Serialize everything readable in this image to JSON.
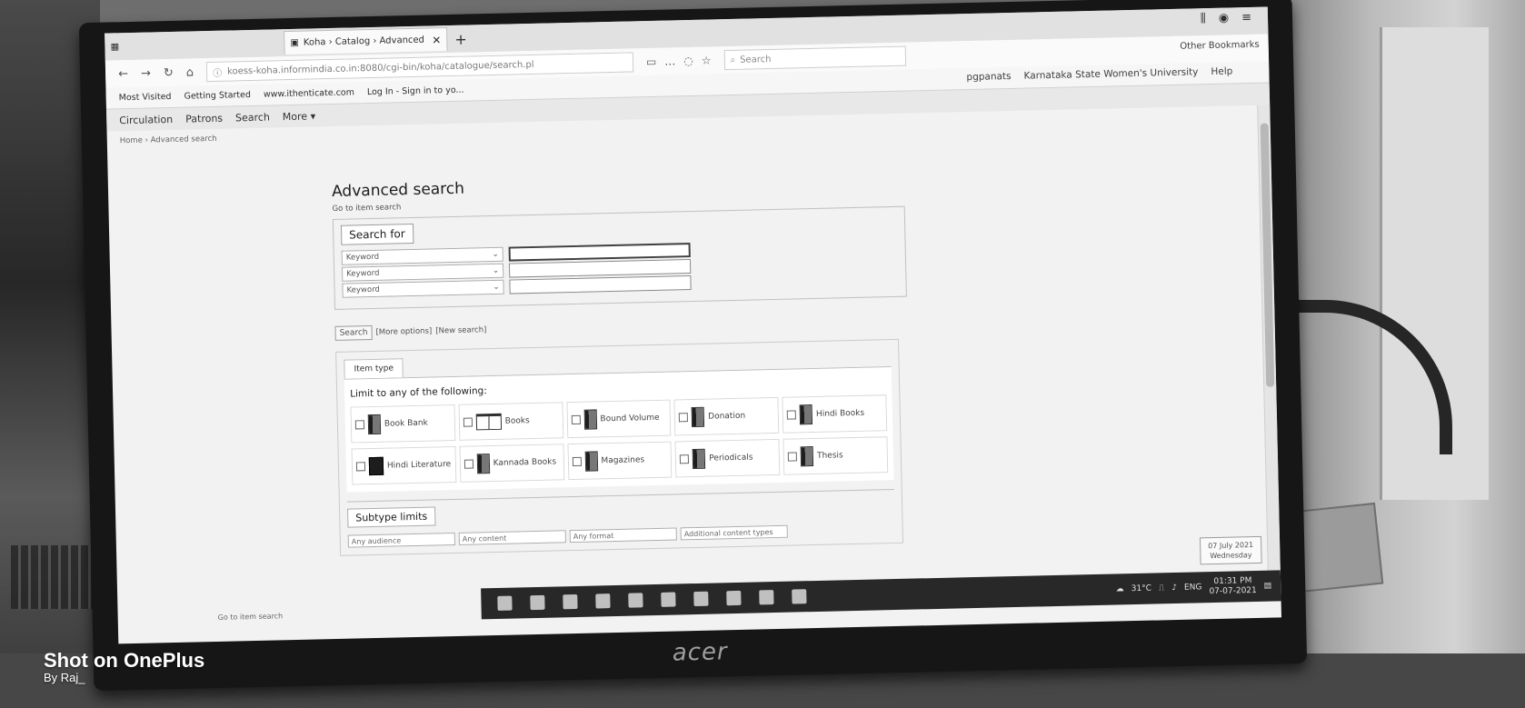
{
  "browser": {
    "tab_title": "Koha › Catalog › Advanced sea",
    "url": "koess-koha.informindia.co.in:8080/cgi-bin/koha/catalogue/search.pl",
    "search_placeholder": "Search",
    "other_bookmarks": "Other Bookmarks",
    "bookmarks": [
      "Most Visited",
      "Getting Started",
      "www.ithenticate.com",
      "Log In - Sign in to yo..."
    ]
  },
  "koha": {
    "user": "pgpanats",
    "library": "Karnataka State Women's University",
    "help": "Help",
    "nav": [
      "Circulation",
      "Patrons",
      "Search",
      "More"
    ],
    "breadcrumb": "Home › Advanced search"
  },
  "page": {
    "title": "Advanced search",
    "item_search_link": "Go to item search",
    "search_for_legend": "Search for",
    "index_rows": [
      "Keyword",
      "Keyword",
      "Keyword"
    ],
    "search_button": "Search",
    "more_options": "[More options]",
    "new_search": "[New search]",
    "tab_item_type": "Item type",
    "limit_title": "Limit to any of the following:",
    "item_types": [
      {
        "label": "Book Bank",
        "icon": "book-icon"
      },
      {
        "label": "Books",
        "icon": "open-book-icon"
      },
      {
        "label": "Bound Volume",
        "icon": "book-icon"
      },
      {
        "label": "Donation",
        "icon": "book-icon"
      },
      {
        "label": "Hindi Books",
        "icon": "book-icon"
      },
      {
        "label": "Hindi Literature",
        "icon": "literature-icon"
      },
      {
        "label": "Kannada Books",
        "icon": "book-icon"
      },
      {
        "label": "Magazines",
        "icon": "magazine-icon"
      },
      {
        "label": "Periodicals",
        "icon": "periodical-icon"
      },
      {
        "label": "Thesis",
        "icon": "thesis-icon"
      }
    ],
    "subtype_title": "Subtype limits",
    "subtype_selects": [
      "Any audience",
      "Any content",
      "Any format",
      "Additional content types"
    ],
    "bottom_link": "Go to item search"
  },
  "taskbar": {
    "weather": "31°C",
    "lang": "ENG",
    "time": "01:31 PM",
    "date": "07-07-2021",
    "date_popup_line1": "07 July 2021",
    "date_popup_line2": "Wednesday"
  },
  "monitor_brand": "acer",
  "watermark": {
    "line1": "Shot on OnePlus",
    "line2": "By Raj_"
  }
}
